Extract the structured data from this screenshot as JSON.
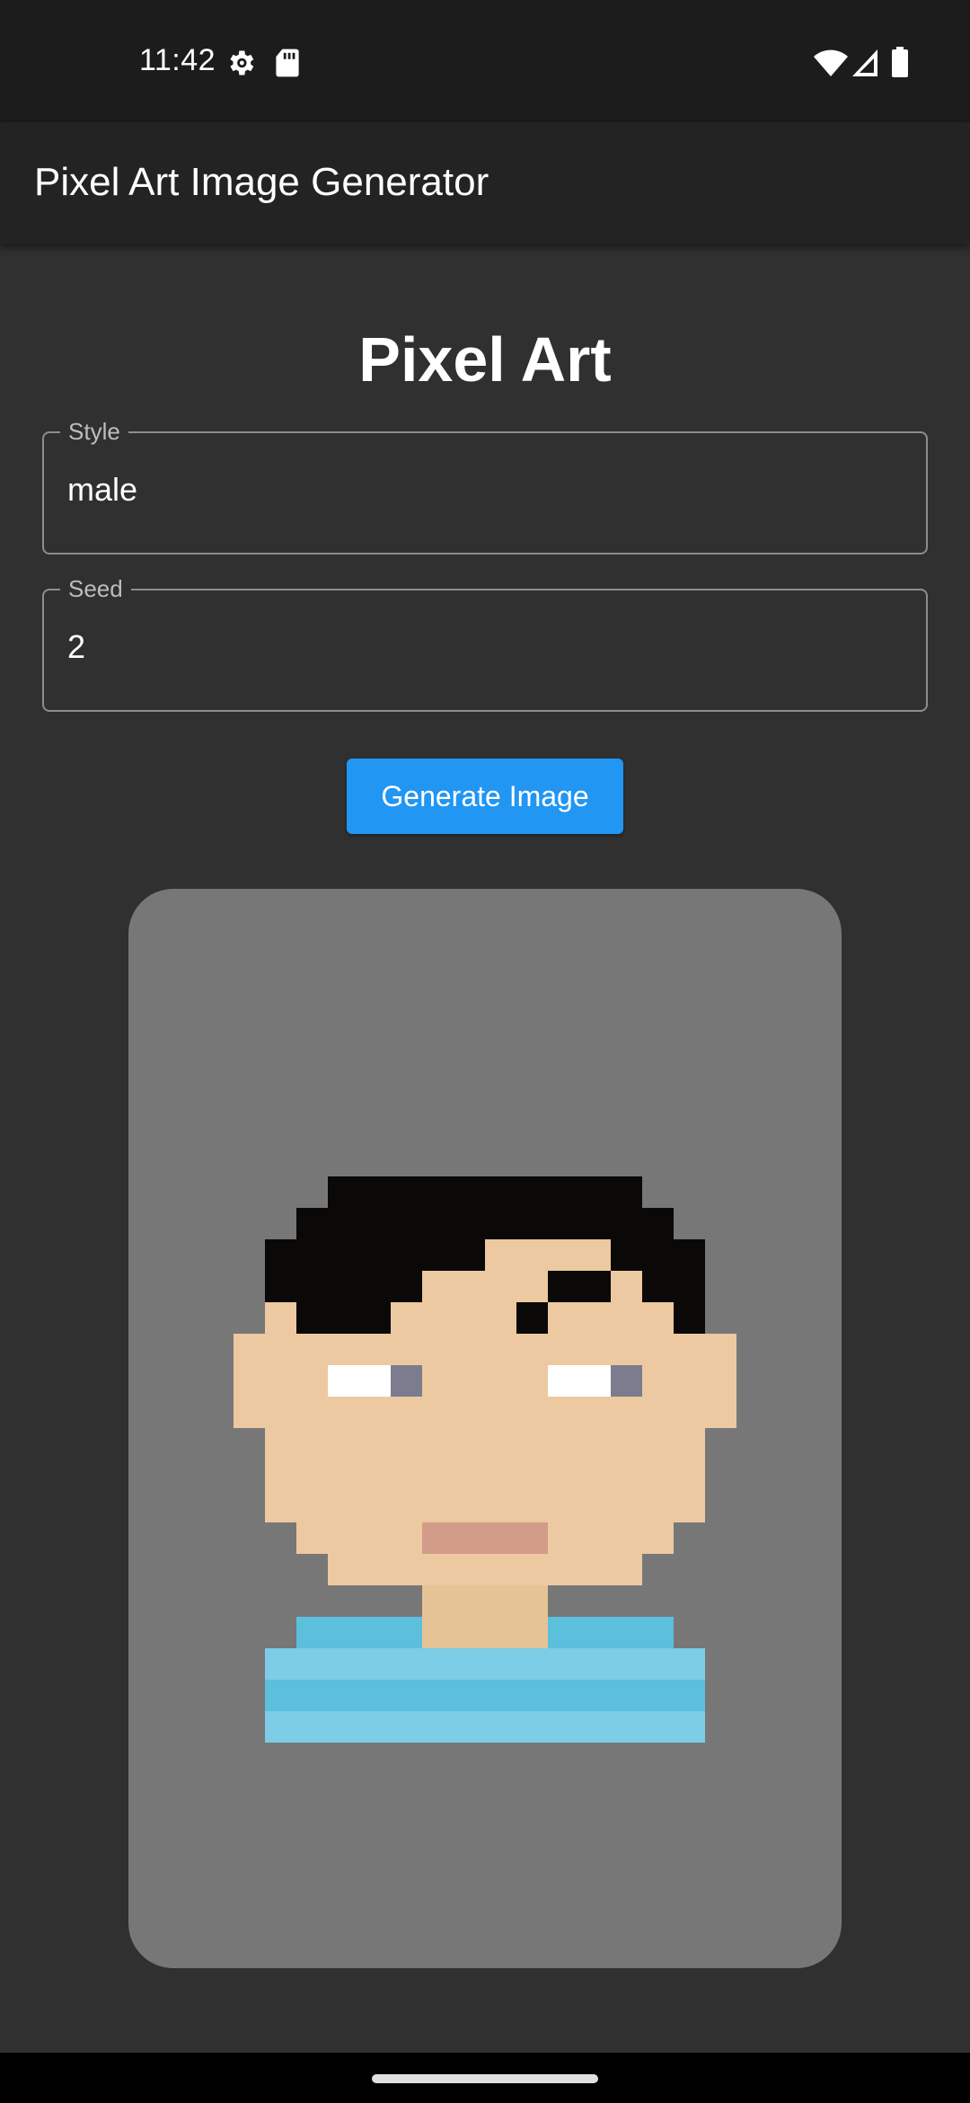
{
  "status_bar": {
    "time": "11:42",
    "icons": [
      "gear-icon",
      "sd-card-icon",
      "wifi-icon",
      "signal-icon",
      "battery-icon"
    ]
  },
  "app_bar": {
    "title": "Pixel Art Image Generator"
  },
  "main": {
    "heading": "Pixel Art",
    "style_field": {
      "label": "Style",
      "value": "male"
    },
    "seed_field": {
      "label": "Seed",
      "value": "2"
    },
    "generate_button": "Generate Image"
  },
  "generated_image": {
    "description_icon": "pixel-avatar",
    "colors": {
      "background": "#777777",
      "hair": "#0b0908",
      "skin": "#ecc9a0",
      "eye_white": "#ffffff",
      "pupil": "#7c7c8e",
      "mouth": "#d39c88",
      "neck": "#e6c394",
      "shirt_dark": "#5cbfdc",
      "shirt_light": "#7ccde5"
    }
  },
  "colors": {
    "accent": "#2196f3",
    "background": "#303030",
    "app_bar": "#232323"
  }
}
